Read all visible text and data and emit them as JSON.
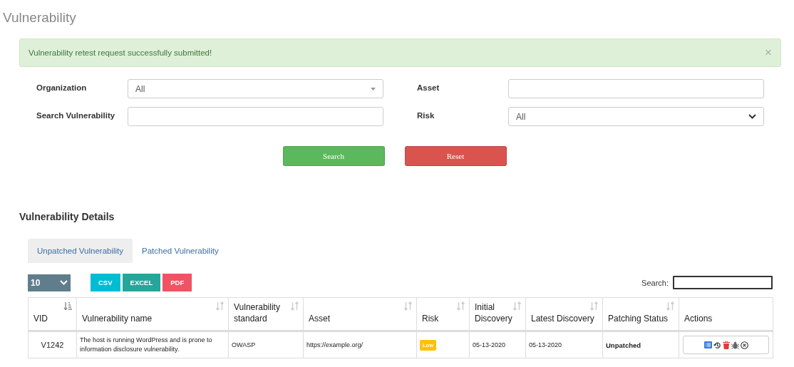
{
  "page_title": "Vulnerability",
  "alert": {
    "message": "Vulnerability retest request successfully submitted!",
    "close": "×"
  },
  "filters": [
    {
      "label": "Organization",
      "kind": "combo",
      "value": "All"
    },
    {
      "label": "Asset",
      "kind": "text"
    },
    {
      "label": "Search Vulnerability",
      "kind": "text"
    },
    {
      "label": "Risk",
      "kind": "select",
      "value": "All"
    }
  ],
  "form_buttons": [
    {
      "label": "Search",
      "color": "#5cb85c"
    },
    {
      "label": "Reset",
      "color": "#d9534f"
    }
  ],
  "section_title": "Vulnerability Details",
  "tabs": [
    {
      "label": "Unpatched Vulnerability",
      "selected": true
    },
    {
      "label": "Patched Vulnerability",
      "selected": false
    }
  ],
  "page_length": "10",
  "export_buttons": [
    {
      "label": "CSV",
      "color": "#00bcd4"
    },
    {
      "label": "EXCEL",
      "color": "#26a69a"
    },
    {
      "label": "PDF",
      "color": "#ef5364"
    }
  ],
  "search_label": "Search:",
  "table": {
    "columns": [
      {
        "label": "VID",
        "kind": "sorted"
      },
      {
        "label": "Vulnerability name",
        "kind": "sortable"
      },
      {
        "label": "Vulnerability standard",
        "kind": "sortable"
      },
      {
        "label": "Asset",
        "kind": "sortable"
      },
      {
        "label": "Risk",
        "kind": "sortable"
      },
      {
        "label": "Initial Discovery",
        "kind": "sortable"
      },
      {
        "label": "Latest Discovery",
        "kind": "sortable"
      },
      {
        "label": "Patching Status",
        "kind": "sortable"
      },
      {
        "label": "Actions",
        "kind": "plain"
      }
    ],
    "rows": [
      {
        "vid": "V1242",
        "name": "The host is running WordPress and is prone to information disclosure vulnerability.",
        "standard": "OWASP",
        "asset": "https://example.org/",
        "risk": {
          "label": "Low",
          "color": "#ffc107"
        },
        "initial": "05-13-2020",
        "latest": "05-13-2020",
        "status": "Unpatched"
      }
    ]
  }
}
